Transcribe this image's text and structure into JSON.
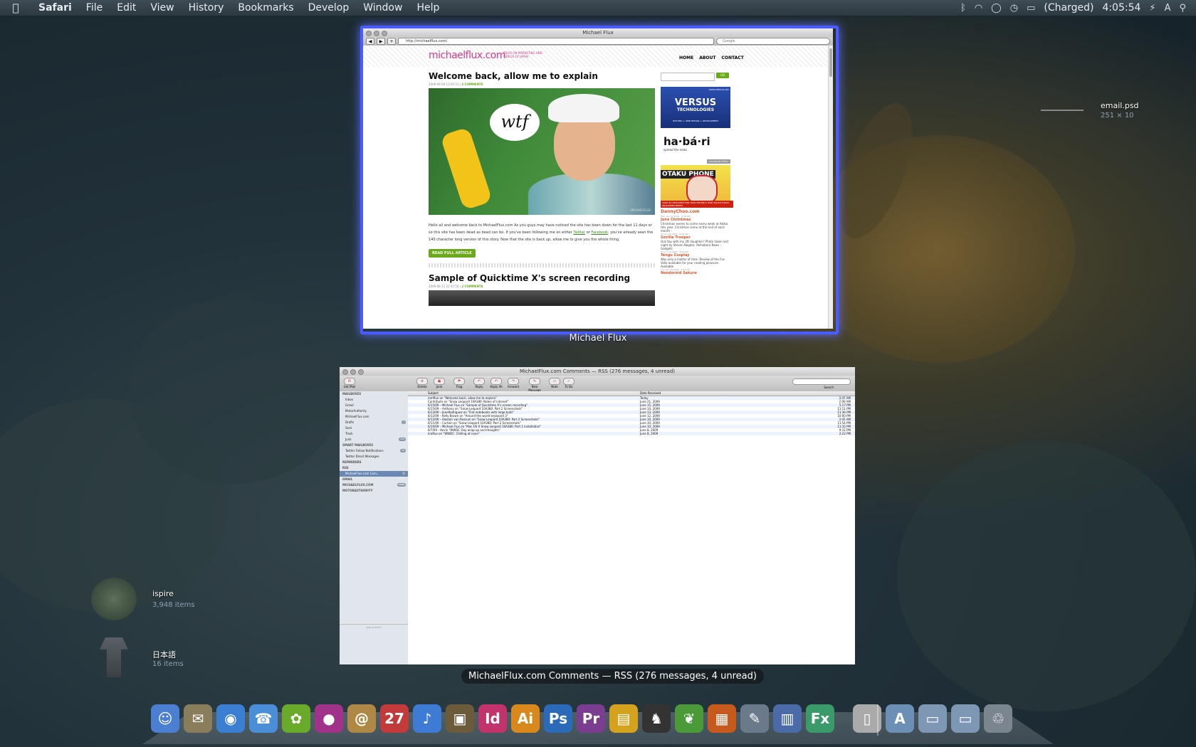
{
  "menubar": {
    "app": "Safari",
    "items": [
      "File",
      "Edit",
      "View",
      "History",
      "Bookmarks",
      "Develop",
      "Window",
      "Help"
    ],
    "charge_status": "(Charged)",
    "clock": "4:05:54"
  },
  "safari": {
    "window_title": "Michael Flux",
    "url": "http://michaelflux.com/",
    "search_placeholder": "Google",
    "expose_label": "Michael Flux",
    "site": {
      "logo": "michaelflux.com",
      "tagline": "IDEAS ON MARKETING AND VIDEOS OF JAPAN",
      "nav": [
        "HOME",
        "ABOUT",
        "CONTACT"
      ],
      "go_button": "GO",
      "post1": {
        "title": "Welcome back, allow me to explain",
        "date": "2009-06-06 13:05:53 | ",
        "comments": "2 COMMENTS",
        "speech": "wtf",
        "watermark": "MICHAELFLUX",
        "body_a": "Hello all and welcome back to MichaelFlux.com As you guys may have noticed the site has been down for the last 11 days or so this site has been dead as dead can be. If you've been following me on either ",
        "link_twitter": "Twitter",
        "body_or": " or ",
        "link_facebook": "Facebook",
        "body_b": ", you've already seen the 140 character long version of this story. Now that the site is back up, allow me to give you the whole thing.",
        "read_more": "READ FULL ARTICLE"
      },
      "post2": {
        "title": "Sample of Quicktime X's screen recording",
        "date": "2009-06-11 22:47:56 | ",
        "comments": "2 COMMENTS"
      },
      "ads": {
        "versus_top": "WWW.VERSUS.ART",
        "versus_name": "VERSUS",
        "versus_sub": "TECHNOLOGIES",
        "versus_bottom": "HOSTING + WEB DESIGN + DEVELOPMENT",
        "habari_name": "ha·bá·ri",
        "habari_sub": "spread the news",
        "habari_tag": "ADVANCED FEEDS",
        "otaku_name": "OTAKU PHONE",
        "otaku_bottom": "YOUR #1 RESOURCE FOR YOUR IPHONE & IPOD TOUCH OTAKU WALLPAPER NEEDS"
      },
      "feed": {
        "source": "DannyChoo.com",
        "items": [
          {
            "date": "Mon, Jun 22 2009 - 6:36 AM",
            "title": "June Christmas",
            "text": "Christmas seems to come every week at Akiba this year. Christmas come at the end of each month –"
          },
          {
            "date": "Fri, Jun 19 2009 - 9:06 AM",
            "title": "Gorilla Trooper",
            "text": "Out day with my 2ft daughter? Photo taken last night by Steven Nagata. Akihabara News – Gadgets"
          },
          {
            "date": "Fri, Jun 19 2009 - 8:02 AM",
            "title": "Tengu Cosplay",
            "text": "Was only a matter of time. Review of the Fox Valle available for your reading pleasure. Available"
          },
          {
            "date": "Thu, Jun 18 2009 - 3:22 AM",
            "title": "Nendoroid Sakura",
            "text": ""
          }
        ]
      }
    }
  },
  "mail": {
    "window_title": "MichaelFlux.com Comments — RSS (276 messages, 4 unread)",
    "expose_label": "MichaelFlux.com Comments — RSS (276 messages, 4 unread)",
    "toolbar": [
      "Get Mail",
      "Delete",
      "Junk",
      "Flag",
      "Reply",
      "Reply All",
      "Forward",
      "New Message",
      "Note",
      "To Do"
    ],
    "search_label": "Search",
    "sidebar": [
      {
        "label": "MAILBOXES",
        "hdr": true,
        "count": ""
      },
      {
        "label": "Inbox",
        "hdr": false,
        "count": ""
      },
      {
        "label": "Gmail",
        "hdr": false,
        "count": ""
      },
      {
        "label": "MotorAuthority",
        "hdr": false,
        "count": ""
      },
      {
        "label": "MichaelFlux.com",
        "hdr": false,
        "count": ""
      },
      {
        "label": "Drafts",
        "hdr": false,
        "count": "1"
      },
      {
        "label": "Sent",
        "hdr": false,
        "count": ""
      },
      {
        "label": "Trash",
        "hdr": false,
        "count": ""
      },
      {
        "label": "Junk",
        "hdr": false,
        "count": "259"
      },
      {
        "label": "SMART MAILBOXES",
        "hdr": true,
        "count": ""
      },
      {
        "label": "Twitter Follow Notifications",
        "hdr": false,
        "count": "56"
      },
      {
        "label": "Twitter Direct Messages",
        "hdr": false,
        "count": ""
      },
      {
        "label": "REMINDERS",
        "hdr": true,
        "count": ""
      },
      {
        "label": "RSS",
        "hdr": true,
        "count": ""
      },
      {
        "label": "MichaelFlux.com Com...",
        "hdr": false,
        "count": "4",
        "sel": true
      },
      {
        "label": "GMAIL",
        "hdr": true,
        "count": ""
      },
      {
        "label": "MICHAELFLUX.COM",
        "hdr": true,
        "count": "1036"
      },
      {
        "label": "MOTORAUTHORITY",
        "hdr": true,
        "count": ""
      }
    ],
    "activity": "MAIL ACTIVITY",
    "columns": {
      "subject": "Subject",
      "date": "Date Received"
    },
    "messages": [
      {
        "subject": "mmflux on \"Welcome back, allow me to explain\"",
        "date": "Today",
        "time": "3:47 AM"
      },
      {
        "subject": "Contribute on \"Snow Leopard 10A380: Notes of interest\"",
        "date": "June 21, 2009",
        "time": "2:00 AM"
      },
      {
        "subject": "6/15/09 – Michael Flux on \"Sample of Quicktime X's screen recording\"",
        "date": "June 15, 2009",
        "time": "5:17 PM"
      },
      {
        "subject": "6/15/09 – Anthony on \"Snow Leopard 10A380: Part 2 Screenshots\"",
        "date": "June 14, 2009",
        "time": "11:11 PM"
      },
      {
        "subject": "6/13/09 – JaneRodriguez on \"Flat notebooks with large bulls\"",
        "date": "June 13, 2009",
        "time": "11:36 PM"
      },
      {
        "subject": "6/12/09 – Kelly Brown on \"Around the world keyboard 3\"",
        "date": "June 12, 2009",
        "time": "10:00 PM"
      },
      {
        "subject": "6/12/09 – Alastair van Rossum on \"Snow Leopard 10A380: Part 2 Screenshots\"",
        "date": "June 10, 2009",
        "time": "3:45 AM"
      },
      {
        "subject": "6/11/09 – Curtain on \"Snow Leopard 10A380: Part 2 Screenshots\"",
        "date": "June 10, 2009",
        "time": "11:54 PM"
      },
      {
        "subject": "6/10/09 – Michael Flux on \"Mac OS X Snow Leopard 10A380: Part 1 Installation\"",
        "date": "June 10, 2009",
        "time": "11:10 PM"
      },
      {
        "subject": "6/7/09 – Kevin \"WWDC Day wrap-up and thoughts\"",
        "date": "June 8, 2009",
        "time": "9:11 PM"
      },
      {
        "subject": "kraflux on \"WWDC: Chilling at noon\"",
        "date": "June 8, 2009",
        "time": "2:22 PM"
      }
    ]
  },
  "desktop": {
    "file1": {
      "name": "email.psd",
      "size": "251 × 10"
    },
    "folder1": {
      "name": "ispire",
      "items": "3,948 items"
    },
    "folder2": {
      "name": "日本語",
      "items": "16 items"
    }
  },
  "dock": [
    {
      "name": "finder",
      "label": "☺",
      "color": "#4a7fd1"
    },
    {
      "name": "mail-stamp",
      "label": "✉",
      "color": "#8a7d5c"
    },
    {
      "name": "safari",
      "label": "◉",
      "color": "#3a7fd1"
    },
    {
      "name": "ichat",
      "label": "☎",
      "color": "#4a8ed8"
    },
    {
      "name": "frog-app",
      "label": "✿",
      "color": "#6aaa2a"
    },
    {
      "name": "system-app",
      "label": "●",
      "color": "#a0328a"
    },
    {
      "name": "address-book",
      "label": "@",
      "color": "#b08845"
    },
    {
      "name": "ical",
      "label": "27",
      "color": "#c33a3a"
    },
    {
      "name": "itunes",
      "label": "♪",
      "color": "#3d7bd4"
    },
    {
      "name": "iphoto",
      "label": "▣",
      "color": "#6b5b3a"
    },
    {
      "name": "indesign",
      "label": "Id",
      "color": "#c2336b"
    },
    {
      "name": "illustrator",
      "label": "Ai",
      "color": "#d9891c"
    },
    {
      "name": "photoshop",
      "label": "Ps",
      "color": "#2b6ab8"
    },
    {
      "name": "premiere",
      "label": "Pr",
      "color": "#7a3d8f"
    },
    {
      "name": "transmit",
      "label": "▤",
      "color": "#d4a21c"
    },
    {
      "name": "twitter-app",
      "label": "♞",
      "color": "#333333"
    },
    {
      "name": "leaf-app",
      "label": "❦",
      "color": "#4a9a3a"
    },
    {
      "name": "keynote",
      "label": "▦",
      "color": "#c55a1c"
    },
    {
      "name": "script-editor",
      "label": "✎",
      "color": "#6a7a8a"
    },
    {
      "name": "activity-monitor",
      "label": "▥",
      "color": "#4a6aa8"
    },
    {
      "name": "flex-builder",
      "label": "Fx",
      "color": "#3a9a6a"
    },
    {
      "name": "document-stack",
      "label": "▯",
      "color": "#aaaaaa"
    },
    {
      "name": "applications-folder",
      "label": "A",
      "color": "#6b8fb5"
    },
    {
      "name": "documents-folder",
      "label": "▭",
      "color": "#7d97b5"
    },
    {
      "name": "downloads-folder",
      "label": "▭",
      "color": "#7d97b5"
    },
    {
      "name": "trash",
      "label": "♲",
      "color": "#7a8590"
    }
  ]
}
